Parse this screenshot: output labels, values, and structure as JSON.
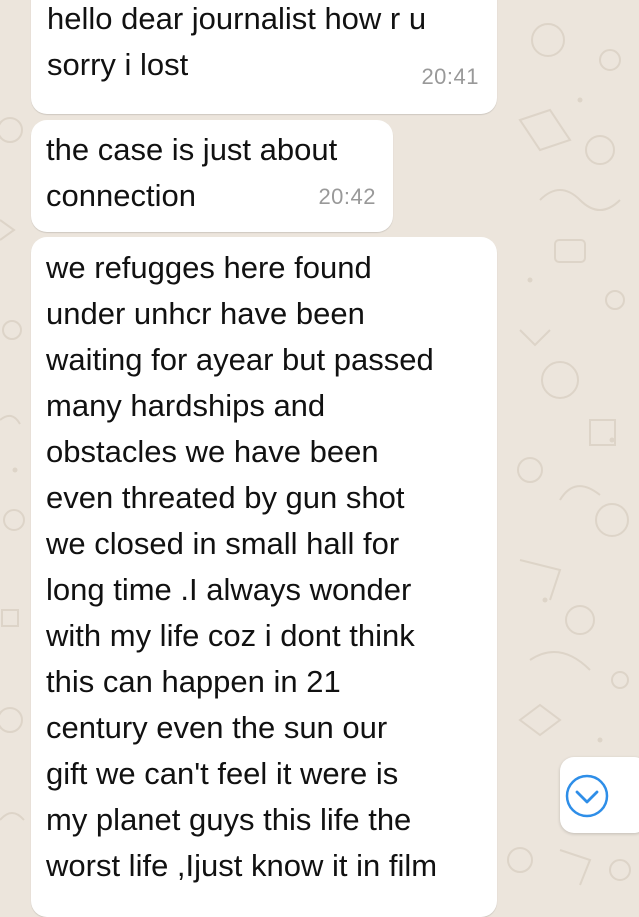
{
  "messages": [
    {
      "text": "hello dear journalist  how r u\nsorry i lost",
      "time": "20:41"
    },
    {
      "text": "the case is just about\nconnection",
      "time": "20:42"
    },
    {
      "text": "we refugges here found\nunder unhcr have been\nwaiting for ayear but passed\nmany hardships and\nobstacles we have been\neven threated by gun shot\nwe closed in small hall for\nlong time .I always wonder\nwith my life coz i dont think\nthis can happen in 21\ncentury even the sun our\ngift we can't feel it were is\nmy planet guys this life the\nworst life ,Ijust know it in film"
    }
  ],
  "scroll_button": {
    "icon": "chevron-down-circle-icon",
    "color": "#2e8ee8"
  },
  "colors": {
    "background": "#ece5dc",
    "bubble": "#ffffff",
    "timestamp": "#999999"
  }
}
